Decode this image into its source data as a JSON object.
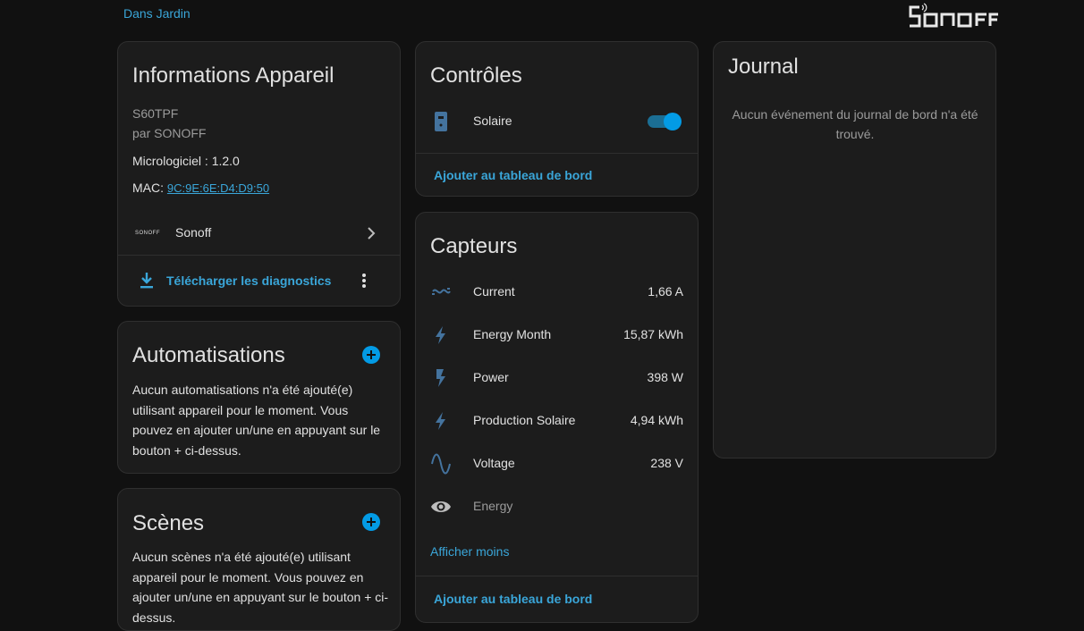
{
  "header": {
    "area_link": "Dans Jardin",
    "brand_logo_text": "SONOFF"
  },
  "device_info": {
    "title": "Informations Appareil",
    "model": "S60TPF",
    "manufacturer": "par SONOFF",
    "firmware": "Micrologiciel : 1.2.0",
    "mac_label": "MAC: ",
    "mac_value": "9C:9E:6E:D4:D9:50",
    "integration_name": "Sonoff",
    "integration_logo_text": "SONOFF",
    "download_label": "Télécharger les diagnostics"
  },
  "automations": {
    "title": "Automatisations",
    "empty_text": "Aucun automatisations n'a été ajouté(e) utilisant appareil pour le moment. Vous pouvez en ajouter un/une en appuyant sur le bouton + ci-dessus."
  },
  "scenes": {
    "title": "Scènes",
    "empty_text": "Aucun scènes n'a été ajouté(e) utilisant appareil pour le moment. Vous pouvez en ajouter un/une en appuyant sur le bouton + ci-dessus."
  },
  "controls": {
    "title": "Contrôles",
    "items": [
      {
        "label": "Solaire",
        "state": "on",
        "icon": "power-socket-icon"
      }
    ],
    "add_to_dashboard": "Ajouter au tableau de bord"
  },
  "sensors": {
    "title": "Capteurs",
    "items": [
      {
        "label": "Current",
        "value": "1,66 A",
        "icon": "current-ac-icon"
      },
      {
        "label": "Energy Month",
        "value": "15,87 kWh",
        "icon": "lightning-bolt-icon"
      },
      {
        "label": "Power",
        "value": "398 W",
        "icon": "flash-icon"
      },
      {
        "label": "Production Solaire",
        "value": "4,94 kWh",
        "icon": "lightning-bolt-icon"
      },
      {
        "label": "Voltage",
        "value": "238 V",
        "icon": "sine-wave-icon"
      },
      {
        "label": "Energy",
        "value": "",
        "icon": "eye-icon"
      }
    ],
    "show_less": "Afficher moins",
    "add_to_dashboard": "Ajouter au tableau de bord"
  },
  "logbook": {
    "title": "Journal",
    "empty_text": "Aucun événement du journal de bord n'a été trouvé."
  },
  "colors": {
    "accent": "#039be5",
    "link": "#3aa6d9",
    "icon": "#44739e",
    "card": "#1c1c1c",
    "background": "#111111"
  }
}
